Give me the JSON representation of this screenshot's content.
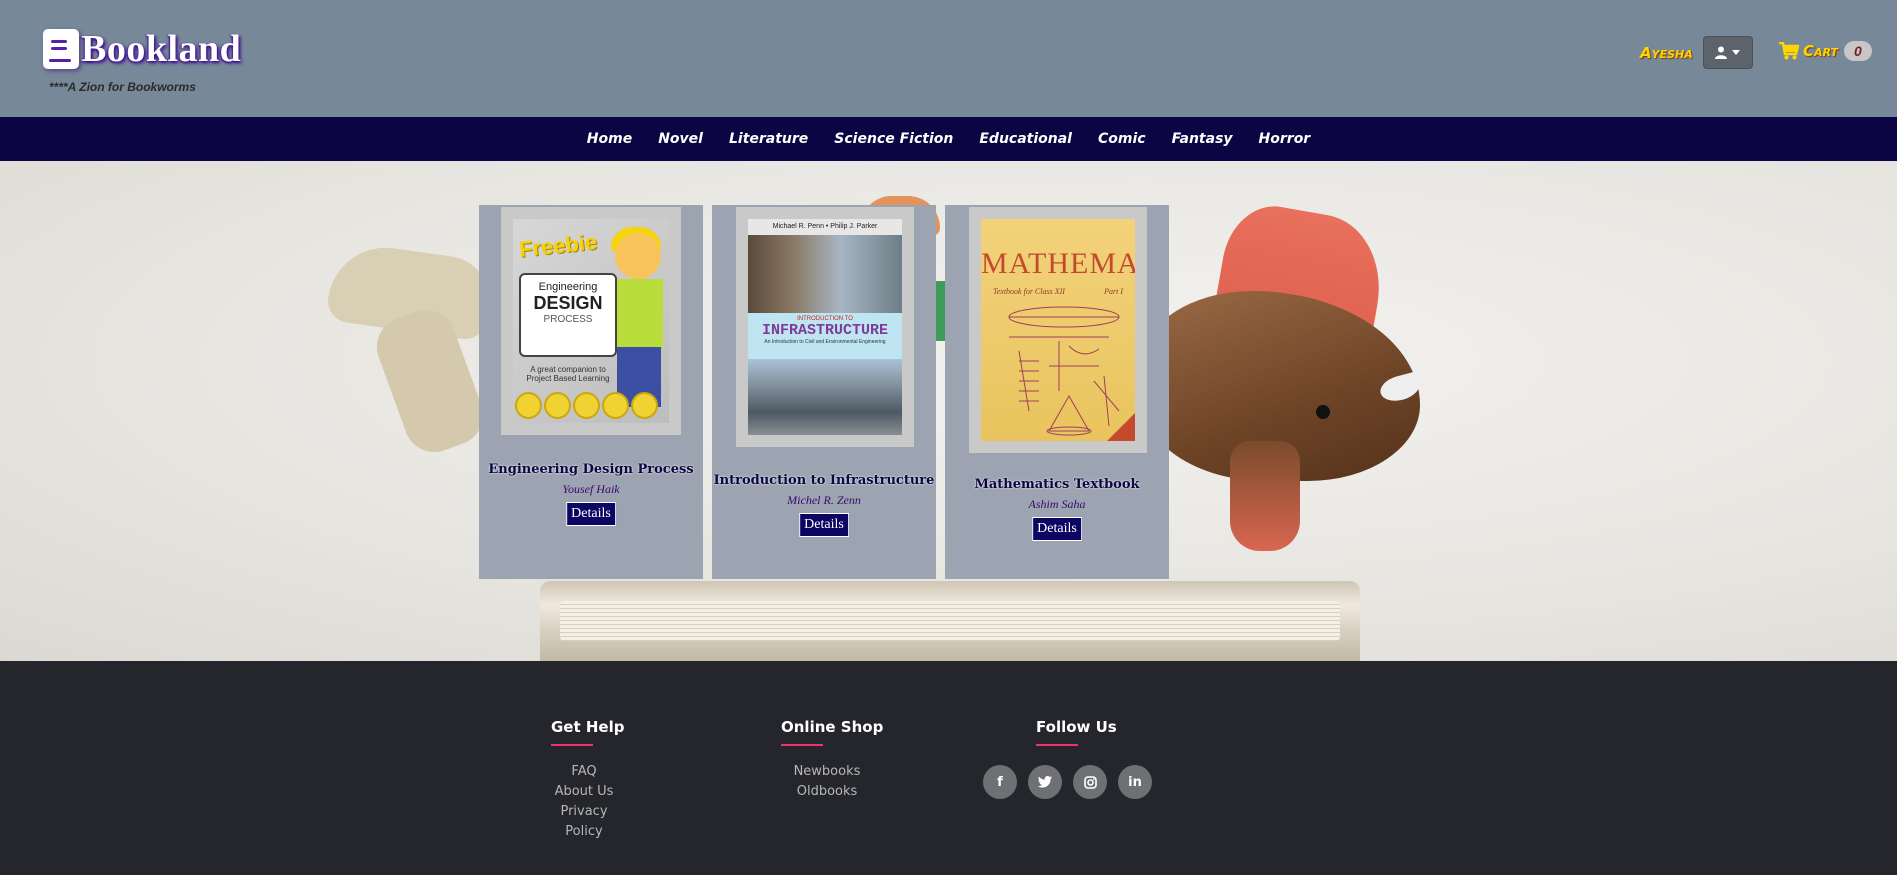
{
  "header": {
    "logo_text": "Bookland",
    "tagline": "****A Zion for Bookworms",
    "user_name": "Ayesha",
    "cart_label": "Cart",
    "cart_count": "0"
  },
  "nav": {
    "items": [
      {
        "label": "Home"
      },
      {
        "label": "Novel"
      },
      {
        "label": "Literature"
      },
      {
        "label": "Science Fiction"
      },
      {
        "label": "Educational"
      },
      {
        "label": "Comic"
      },
      {
        "label": "Fantasy"
      },
      {
        "label": "Horror"
      }
    ]
  },
  "books": [
    {
      "title": "Engineering Design Process",
      "author": "Yousef Haik",
      "button": "Details",
      "cover": {
        "freebie": "Freebie",
        "line1": "Engineering",
        "line2": "DESIGN",
        "line3": "PROCESS",
        "sub": "A great companion to Project Based Learning"
      }
    },
    {
      "title": "Introduction to Infrastructure",
      "author": "Michel R. Zenn",
      "button": "Details",
      "cover": {
        "authors": "Michael R. Penn  •  Philip J. Parker",
        "line1": "INTRODUCTION TO",
        "line2": "INFRASTRUCTURE",
        "line3": "An Introduction to Civil and Environmental Engineering"
      }
    },
    {
      "title": "Mathematics Textbook",
      "author": "Ashim Saha",
      "button": "Details",
      "cover": {
        "title": "MATHEMATICS",
        "subtitle": "Textbook for Class XII",
        "part": "Part I"
      }
    }
  ],
  "footer": {
    "get_help": {
      "heading": "Get Help",
      "links": [
        "FAQ",
        "About Us",
        "Privacy Policy"
      ]
    },
    "online_shop": {
      "heading": "Online Shop",
      "links": [
        "Newbooks",
        "Oldbooks"
      ]
    },
    "follow_us": {
      "heading": "Follow Us",
      "socials": [
        {
          "icon": "facebook-icon",
          "glyph": "f"
        },
        {
          "icon": "twitter-icon",
          "glyph": "t"
        },
        {
          "icon": "instagram-icon",
          "glyph": "◎"
        },
        {
          "icon": "linkedin-icon",
          "glyph": "in"
        }
      ]
    }
  },
  "colors": {
    "header_bg": "#778899",
    "navbar_bg": "#0b0544",
    "card_bg": "#9ba4b0",
    "footer_bg": "#25262b",
    "accent_yellow": "#ffd400",
    "footer_underline": "#e8356d"
  }
}
